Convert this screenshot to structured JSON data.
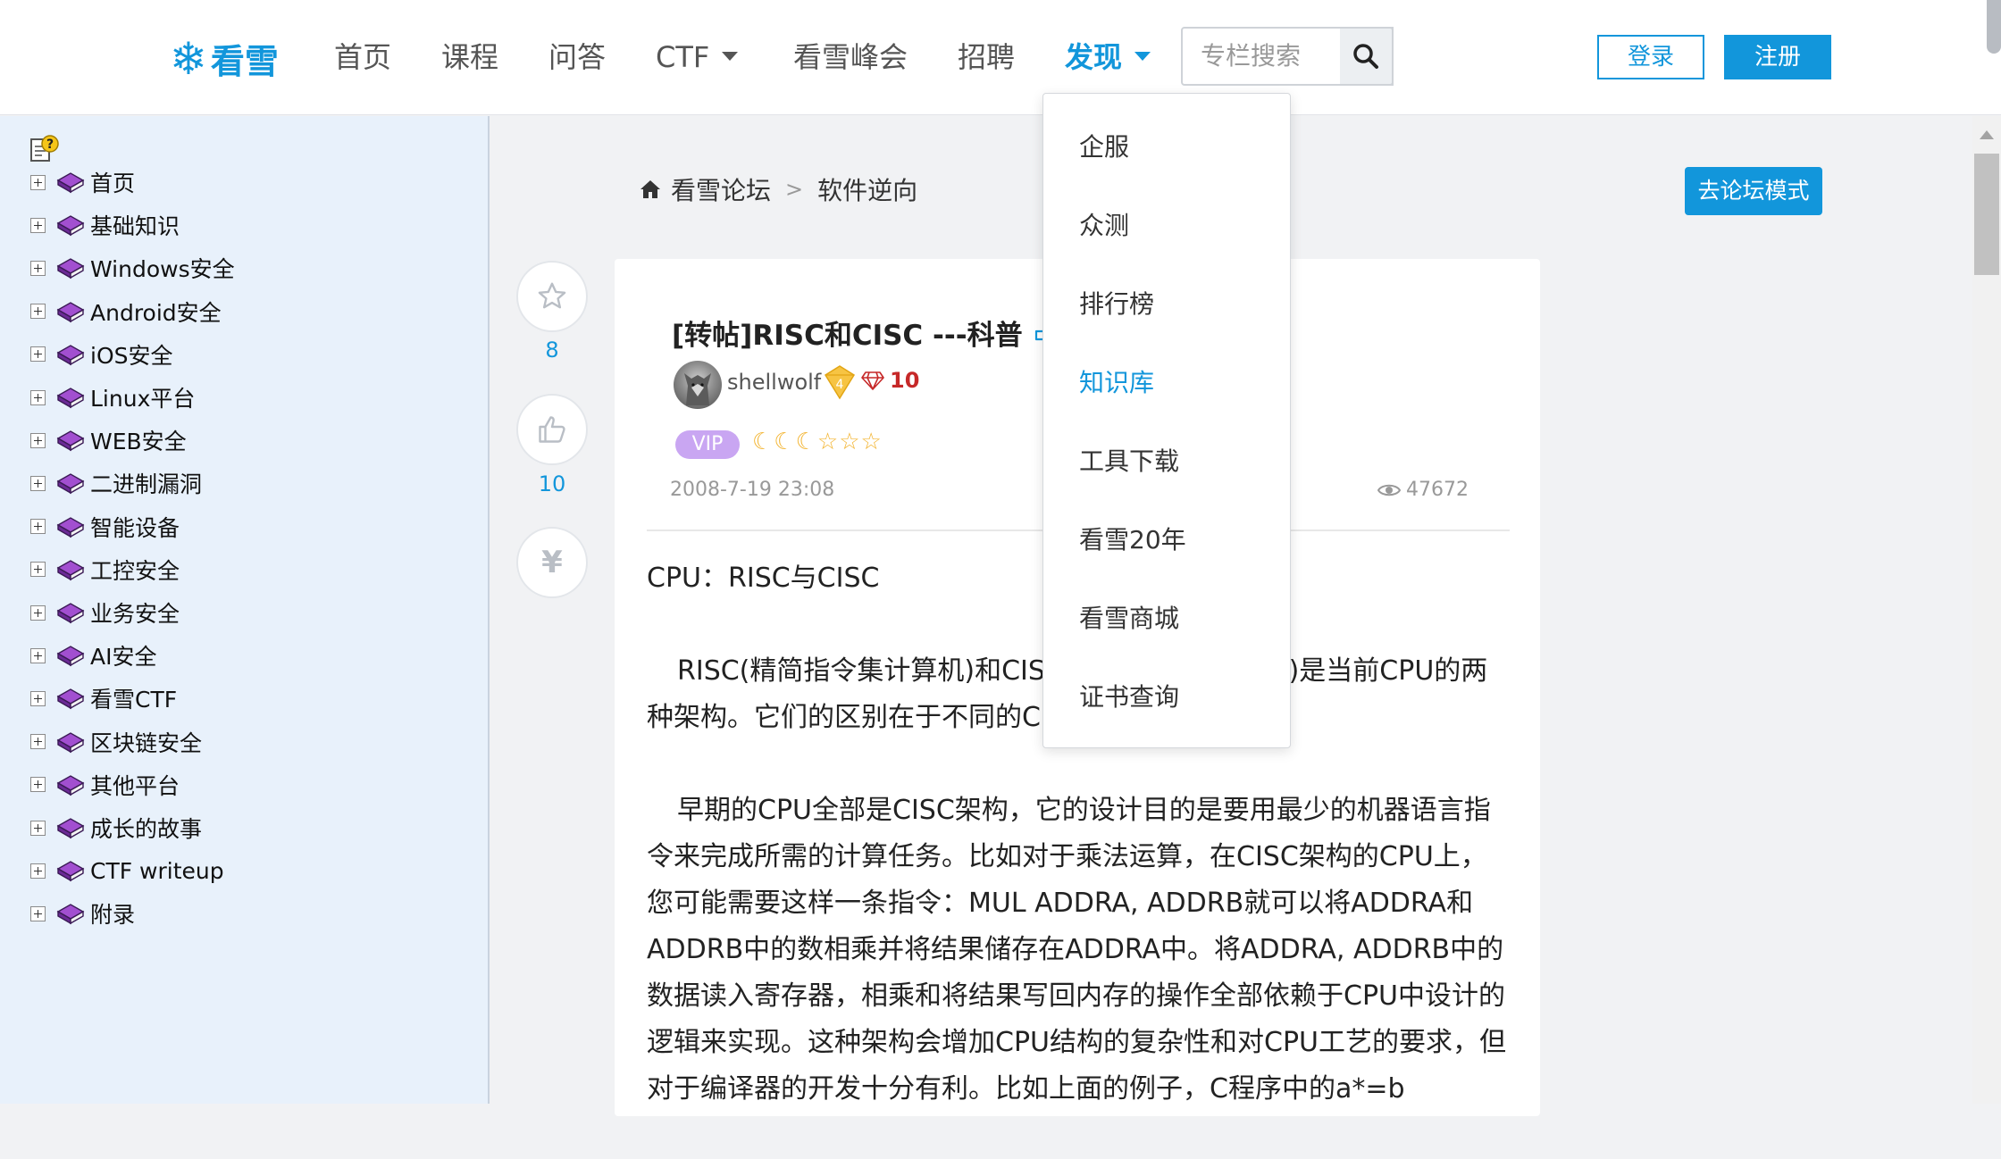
{
  "header": {
    "logo_text": "看雪",
    "nav": {
      "home": "首页",
      "course": "课程",
      "qa": "问答",
      "ctf": "CTF",
      "summit": "看雪峰会",
      "jobs": "招聘",
      "discover": "发现"
    },
    "search": {
      "placeholder": "专栏搜索"
    },
    "login_label": "登录",
    "register_label": "注册"
  },
  "dropdown": {
    "items": [
      "企服",
      "众测",
      "排行榜",
      "知识库",
      "工具下载",
      "看雪20年",
      "看雪商城",
      "证书查询"
    ],
    "active_index": 3
  },
  "sidebar": {
    "items": [
      "首页",
      "基础知识",
      "Windows安全",
      "Android安全",
      "iOS安全",
      "Linux平台",
      "WEB安全",
      "二进制漏洞",
      "智能设备",
      "工控安全",
      "业务安全",
      "AI安全",
      "看雪CTF",
      "区块链安全",
      "其他平台",
      "成长的故事",
      "CTF writeup",
      "附录"
    ]
  },
  "breadcrumb": {
    "forum": "看雪论坛",
    "separator": ">",
    "section": "软件逆向"
  },
  "forum_mode_label": "去论坛模式",
  "actions": {
    "favorites": "8",
    "likes": "10",
    "tip_icon_symbol": "¥"
  },
  "post": {
    "title": "[转帖]RISC和CISC ---科普",
    "author": {
      "name": "shellwolf",
      "level": "4",
      "rank": "10",
      "vip_label": "VIP",
      "stars_text": "☾☾☾☆☆☆"
    },
    "date": "2008-7-19 23:08",
    "views": "47672",
    "paragraphs": [
      "CPU：RISC与CISC",
      "RISC(精简指令集计算机)和CISC(复杂指令集计算机)是当前CPU的两种架构。它们的区别在于不同的CPU设计理念和方法。",
      "早期的CPU全部是CISC架构，它的设计目的是要用最少的机器语言指令来完成所需的计算任务。比如对于乘法运算，在CISC架构的CPU上，您可能需要这样一条指令：MUL ADDRA, ADDRB就可以将ADDRA和ADDRB中的数相乘并将结果储存在ADDRA中。将ADDRA, ADDRB中的数据读入寄存器，相乘和将结果写回内存的操作全部依赖于CPU中设计的逻辑来实现。这种架构会增加CPU结构的复杂性和对CPU工艺的要求，但对于编译器的开发十分有利。比如上面的例子，C程序中的a*=b"
    ]
  },
  "colors": {
    "accent": "#1296db",
    "sidebar_bg": "#e8f1fb",
    "rank_red": "#c62828",
    "vip_purple": "#c9a6f2",
    "star_gold": "#f3b533"
  },
  "icons": {
    "search": "search-icon",
    "favorite": "star-outline-icon",
    "like": "thumbs-up-icon",
    "tip": "yen-icon",
    "home": "home-icon",
    "book": "book-icon",
    "views": "eye-icon",
    "edit": "edit-pointer-icon"
  }
}
